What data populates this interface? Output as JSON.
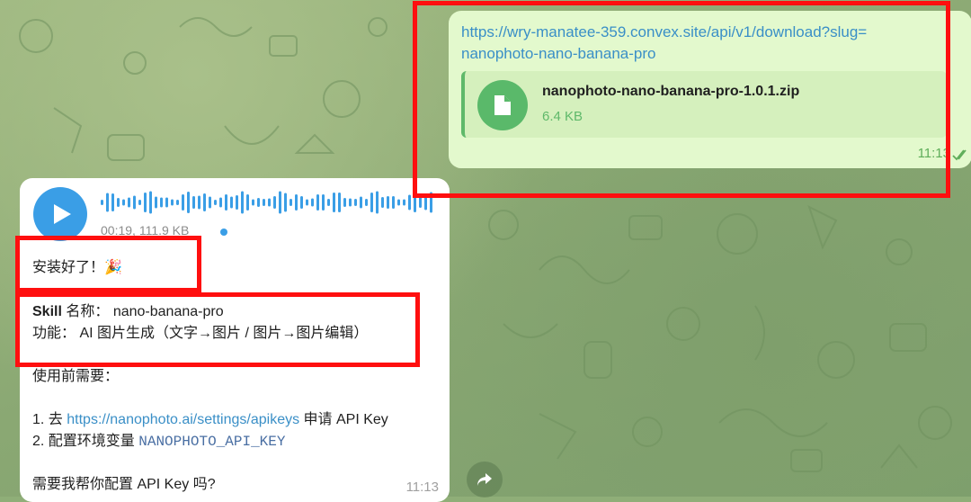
{
  "outgoing_message": {
    "link_text": "https://wry-manatee-359.convex.site/api/v1/download?slug=nanophoto-nano-banana-pro",
    "file": {
      "icon": "document-icon",
      "name": "nanophoto-nano-banana-pro-1.0.1.zip",
      "size": "6.4 KB"
    },
    "time": "11:13",
    "status_icon": "double-check-icon"
  },
  "incoming_message": {
    "voice": {
      "duration": "00:19",
      "size": "111.9 KB",
      "play_icon": "play-icon"
    },
    "line_installed": "安装好了！🎉",
    "skill_label": "Skill",
    "skill_name_label": "名称：",
    "skill_name": "nano-banana-pro",
    "function_label": "功能：",
    "function_value": "AI 图片生成（文字→图片 / 图片→图片编辑）",
    "before_use": "使用前需要：",
    "step1_prefix": "1. 去",
    "step1_link": "https://nanophoto.ai/settings/apikeys",
    "step1_suffix": "申请 API Key",
    "step2_prefix": "2. 配置环境变量",
    "step2_code": "NANOPHOTO_API_KEY",
    "question": "需要我帮你配置 API Key 吗?",
    "time": "11:13"
  },
  "share_button": {
    "icon": "share-arrow-icon"
  },
  "colors": {
    "annotation_red": "#ff0f0f",
    "outgoing_bubble": "#e3f9cd",
    "link_blue": "#3a8fc7",
    "file_green": "#5ab96a",
    "play_blue": "#3a9ee6"
  }
}
